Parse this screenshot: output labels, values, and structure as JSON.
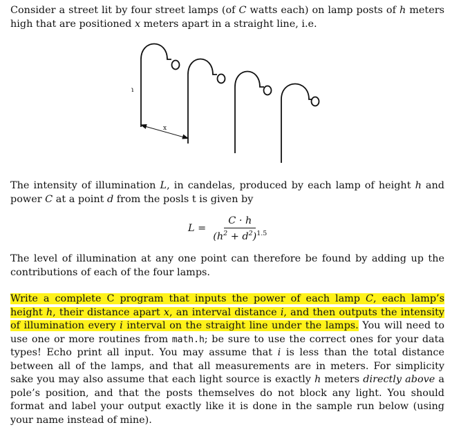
{
  "intro": {
    "t1": "Consider a street lit by four street lamps (of ",
    "C": "C",
    "t2": " watts each) on lamp posts of ",
    "h": "h",
    "t3": " meters high that are positioned ",
    "x": "x",
    "t4": " meters apart in a straight line, i.e."
  },
  "figure": {
    "height_label": "h",
    "distance_label": "x",
    "lamp_count": 4
  },
  "intensity": {
    "t1": "The intensity of illumination ",
    "L": "L",
    "t2": ", in candelas, produced by each lamp of height ",
    "h": "h",
    "t3": " and power ",
    "C": "C",
    "t4": " at a point ",
    "d": "d",
    "t5": " from the posls t is given by"
  },
  "formula": {
    "lhs": "L =",
    "numerator": "C · h",
    "den_open": "(h",
    "den_exp1": "2",
    "den_plus": " + d",
    "den_exp2": "2",
    "den_close": ")",
    "den_exp3": "1.5"
  },
  "level": {
    "text": "The level of illumination at any one point can therefore be found by adding up the contributions of each of the four lamps."
  },
  "task": {
    "hl1": "Write a complete C program that inputs the power of each lamp ",
    "C": "C",
    "hl2": ", each lamp’s height ",
    "h": "h",
    "hl3": ", their distance apart ",
    "x": "x",
    "hl4": ", an interval distance ",
    "i1": "i",
    "hl5": ", and then outputs the intensity of illumination every ",
    "i2": "i",
    "hl6": " interval on the straight line under the lamps.",
    "t1": " You will need to use one or more routines from ",
    "code": "math.h",
    "t2": "; be sure to use the correct ones for your data types! Echo print all input. You may assume that ",
    "i3": "i",
    "t3": " is less than the total distance between all of the lamps, and that all measurements are in meters. For simplicity sake you may also assume that each light source is exactly ",
    "h2": "h",
    "t4": " meters ",
    "em": "directly above",
    "t5": " a pole’s position, and that the posts themselves do not block any light. You should format and label your output exactly like it is done in the sample run below (using your name instead of mine)."
  }
}
